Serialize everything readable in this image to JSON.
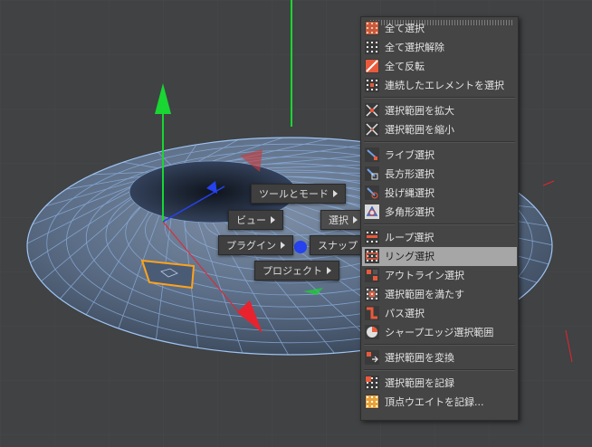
{
  "quad_menu": {
    "tool_mode": "ツールとモード",
    "view": "ビュー",
    "select": "選択",
    "plugins": "プラグイン",
    "snap": "スナップ",
    "project": "プロジェクト"
  },
  "selection_menu": {
    "items": [
      {
        "label": "全て選択",
        "icon": "select-all-icon"
      },
      {
        "label": "全て選択解除",
        "icon": "deselect-all-icon"
      },
      {
        "label": "全て反転",
        "icon": "invert-selection-icon"
      },
      {
        "label": "連続したエレメントを選択",
        "icon": "select-connected-icon"
      },
      {
        "label": "選択範囲を拡大",
        "icon": "grow-selection-icon"
      },
      {
        "label": "選択範囲を縮小",
        "icon": "shrink-selection-icon"
      },
      {
        "label": "ライブ選択",
        "icon": "live-selection-icon"
      },
      {
        "label": "長方形選択",
        "icon": "rectangle-selection-icon"
      },
      {
        "label": "投げ縄選択",
        "icon": "lasso-selection-icon"
      },
      {
        "label": "多角形選択",
        "icon": "polygon-selection-icon"
      },
      {
        "label": "ループ選択",
        "icon": "loop-selection-icon"
      },
      {
        "label": "リング選択",
        "icon": "ring-selection-icon"
      },
      {
        "label": "アウトライン選択",
        "icon": "outline-selection-icon"
      },
      {
        "label": "選択範囲を満たす",
        "icon": "fill-selection-icon"
      },
      {
        "label": "パス選択",
        "icon": "path-selection-icon"
      },
      {
        "label": "シャープエッジ選択範囲",
        "icon": "phong-break-selection-icon"
      },
      {
        "label": "選択範囲を変換",
        "icon": "convert-selection-icon"
      },
      {
        "label": "選択範囲を記録",
        "icon": "set-selection-icon"
      },
      {
        "label": "頂点ウエイトを記録...",
        "icon": "set-vertex-weight-icon"
      }
    ],
    "highlighted_index": 11
  },
  "colors": {
    "viewport_bg": "#404244",
    "mesh_fill": "#5c6e87",
    "wire": "#8fb4e6",
    "axis_y": "#19d632",
    "axis_x": "#e8232d",
    "axis_z": "#2642ee",
    "selection": "#ffa31a",
    "menu_bg": "#454545",
    "highlight": "#a6a6a6"
  }
}
